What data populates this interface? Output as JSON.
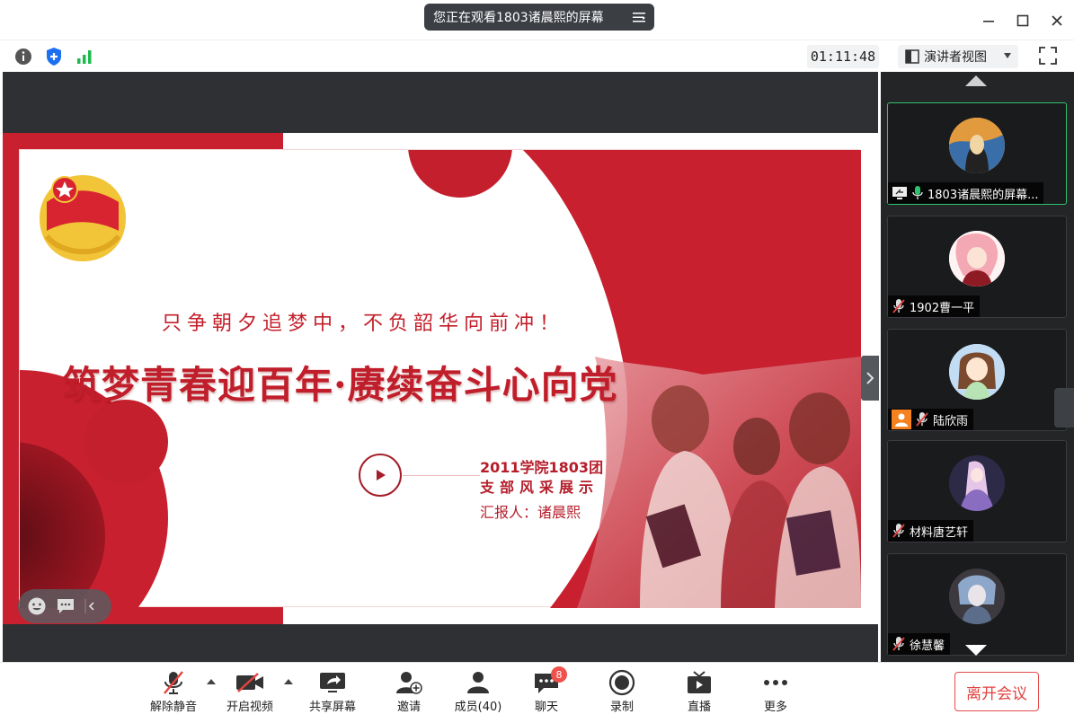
{
  "title_bar": {
    "banner_text": "您正在观看1803诸晨熙的屏幕"
  },
  "toolbar": {
    "timer": "01:11:48",
    "view_mode": "演讲者视图"
  },
  "slide": {
    "slogan": "只争朝夕追梦中，不负韶华向前冲！",
    "headline": "筑梦青春迎百年·赓续奋斗心向党",
    "subtitle_line1": "2011学院1803团",
    "subtitle_line2": "支部风采展示",
    "reporter": "汇报人：诸晨熙",
    "emblem_text": "中国共青团"
  },
  "participants": [
    {
      "name": "1803诸晨熙的屏幕...",
      "sharing": true,
      "muted": false
    },
    {
      "name": "1902曹一平",
      "sharing": false,
      "muted": true
    },
    {
      "name": "陆欣雨",
      "sharing": false,
      "muted": true
    },
    {
      "name": "材料唐艺轩",
      "sharing": false,
      "muted": true
    },
    {
      "name": "徐慧馨",
      "sharing": false,
      "muted": true
    }
  ],
  "bottom_bar": {
    "unmute": "解除静音",
    "start_video": "开启视频",
    "share_screen": "共享屏幕",
    "invite": "邀请",
    "members": "成员(40)",
    "chat": "聊天",
    "chat_badge": "8",
    "record": "录制",
    "live": "直播",
    "more": "更多",
    "leave": "离开会议"
  },
  "colors": {
    "accent_red": "#c8202f",
    "active_border": "#2fc26c",
    "leave_red": "#e2403f",
    "badge_red": "#f0524b"
  }
}
